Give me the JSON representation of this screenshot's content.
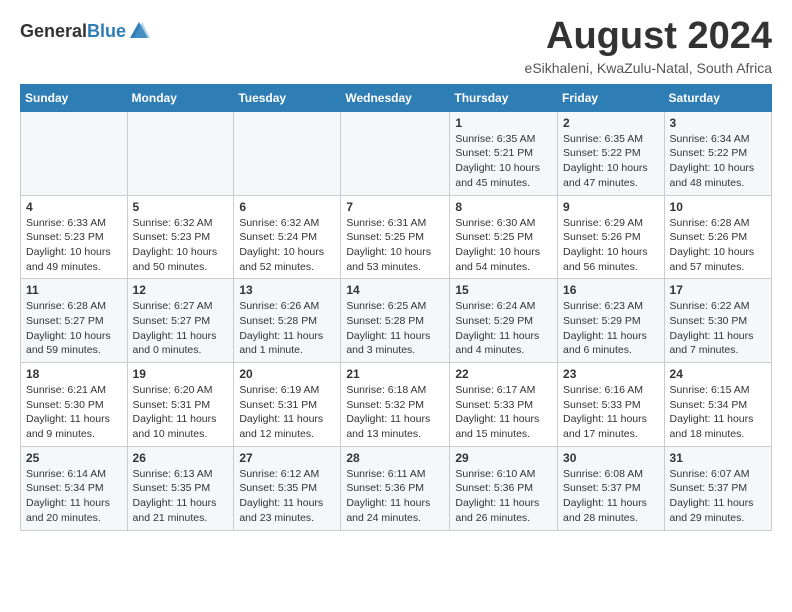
{
  "header": {
    "logo_general": "General",
    "logo_blue": "Blue",
    "title": "August 2024",
    "subtitle": "eSikhaleni, KwaZulu-Natal, South Africa"
  },
  "columns": [
    "Sunday",
    "Monday",
    "Tuesday",
    "Wednesday",
    "Thursday",
    "Friday",
    "Saturday"
  ],
  "weeks": [
    [
      {
        "day": "",
        "info": ""
      },
      {
        "day": "",
        "info": ""
      },
      {
        "day": "",
        "info": ""
      },
      {
        "day": "",
        "info": ""
      },
      {
        "day": "1",
        "info": "Sunrise: 6:35 AM\nSunset: 5:21 PM\nDaylight: 10 hours and 45 minutes."
      },
      {
        "day": "2",
        "info": "Sunrise: 6:35 AM\nSunset: 5:22 PM\nDaylight: 10 hours and 47 minutes."
      },
      {
        "day": "3",
        "info": "Sunrise: 6:34 AM\nSunset: 5:22 PM\nDaylight: 10 hours and 48 minutes."
      }
    ],
    [
      {
        "day": "4",
        "info": "Sunrise: 6:33 AM\nSunset: 5:23 PM\nDaylight: 10 hours and 49 minutes."
      },
      {
        "day": "5",
        "info": "Sunrise: 6:32 AM\nSunset: 5:23 PM\nDaylight: 10 hours and 50 minutes."
      },
      {
        "day": "6",
        "info": "Sunrise: 6:32 AM\nSunset: 5:24 PM\nDaylight: 10 hours and 52 minutes."
      },
      {
        "day": "7",
        "info": "Sunrise: 6:31 AM\nSunset: 5:25 PM\nDaylight: 10 hours and 53 minutes."
      },
      {
        "day": "8",
        "info": "Sunrise: 6:30 AM\nSunset: 5:25 PM\nDaylight: 10 hours and 54 minutes."
      },
      {
        "day": "9",
        "info": "Sunrise: 6:29 AM\nSunset: 5:26 PM\nDaylight: 10 hours and 56 minutes."
      },
      {
        "day": "10",
        "info": "Sunrise: 6:28 AM\nSunset: 5:26 PM\nDaylight: 10 hours and 57 minutes."
      }
    ],
    [
      {
        "day": "11",
        "info": "Sunrise: 6:28 AM\nSunset: 5:27 PM\nDaylight: 10 hours and 59 minutes."
      },
      {
        "day": "12",
        "info": "Sunrise: 6:27 AM\nSunset: 5:27 PM\nDaylight: 11 hours and 0 minutes."
      },
      {
        "day": "13",
        "info": "Sunrise: 6:26 AM\nSunset: 5:28 PM\nDaylight: 11 hours and 1 minute."
      },
      {
        "day": "14",
        "info": "Sunrise: 6:25 AM\nSunset: 5:28 PM\nDaylight: 11 hours and 3 minutes."
      },
      {
        "day": "15",
        "info": "Sunrise: 6:24 AM\nSunset: 5:29 PM\nDaylight: 11 hours and 4 minutes."
      },
      {
        "day": "16",
        "info": "Sunrise: 6:23 AM\nSunset: 5:29 PM\nDaylight: 11 hours and 6 minutes."
      },
      {
        "day": "17",
        "info": "Sunrise: 6:22 AM\nSunset: 5:30 PM\nDaylight: 11 hours and 7 minutes."
      }
    ],
    [
      {
        "day": "18",
        "info": "Sunrise: 6:21 AM\nSunset: 5:30 PM\nDaylight: 11 hours and 9 minutes."
      },
      {
        "day": "19",
        "info": "Sunrise: 6:20 AM\nSunset: 5:31 PM\nDaylight: 11 hours and 10 minutes."
      },
      {
        "day": "20",
        "info": "Sunrise: 6:19 AM\nSunset: 5:31 PM\nDaylight: 11 hours and 12 minutes."
      },
      {
        "day": "21",
        "info": "Sunrise: 6:18 AM\nSunset: 5:32 PM\nDaylight: 11 hours and 13 minutes."
      },
      {
        "day": "22",
        "info": "Sunrise: 6:17 AM\nSunset: 5:33 PM\nDaylight: 11 hours and 15 minutes."
      },
      {
        "day": "23",
        "info": "Sunrise: 6:16 AM\nSunset: 5:33 PM\nDaylight: 11 hours and 17 minutes."
      },
      {
        "day": "24",
        "info": "Sunrise: 6:15 AM\nSunset: 5:34 PM\nDaylight: 11 hours and 18 minutes."
      }
    ],
    [
      {
        "day": "25",
        "info": "Sunrise: 6:14 AM\nSunset: 5:34 PM\nDaylight: 11 hours and 20 minutes."
      },
      {
        "day": "26",
        "info": "Sunrise: 6:13 AM\nSunset: 5:35 PM\nDaylight: 11 hours and 21 minutes."
      },
      {
        "day": "27",
        "info": "Sunrise: 6:12 AM\nSunset: 5:35 PM\nDaylight: 11 hours and 23 minutes."
      },
      {
        "day": "28",
        "info": "Sunrise: 6:11 AM\nSunset: 5:36 PM\nDaylight: 11 hours and 24 minutes."
      },
      {
        "day": "29",
        "info": "Sunrise: 6:10 AM\nSunset: 5:36 PM\nDaylight: 11 hours and 26 minutes."
      },
      {
        "day": "30",
        "info": "Sunrise: 6:08 AM\nSunset: 5:37 PM\nDaylight: 11 hours and 28 minutes."
      },
      {
        "day": "31",
        "info": "Sunrise: 6:07 AM\nSunset: 5:37 PM\nDaylight: 11 hours and 29 minutes."
      }
    ]
  ]
}
